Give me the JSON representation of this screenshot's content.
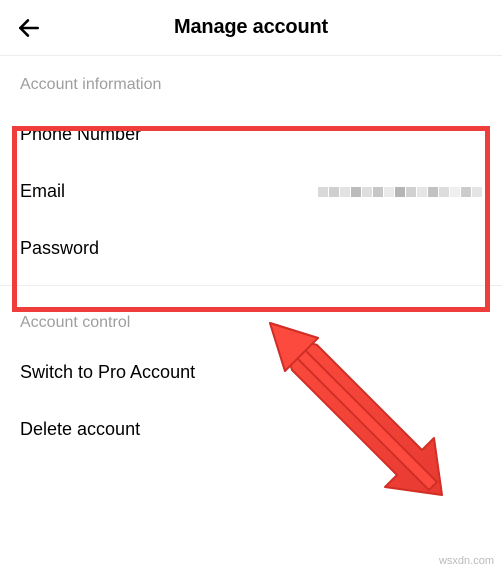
{
  "header": {
    "title": "Manage account"
  },
  "sections": {
    "info": {
      "header": "Account information",
      "phone_label": "Phone Number",
      "email_label": "Email",
      "password_label": "Password"
    },
    "control": {
      "header": "Account control",
      "switch_pro_label": "Switch to Pro Account",
      "delete_label": "Delete account"
    }
  },
  "watermark": "wsxdn.com",
  "colors": {
    "highlight": "#ef3d3b",
    "arrow_fill": "#fc4b3e",
    "arrow_stroke": "#d12e26"
  }
}
